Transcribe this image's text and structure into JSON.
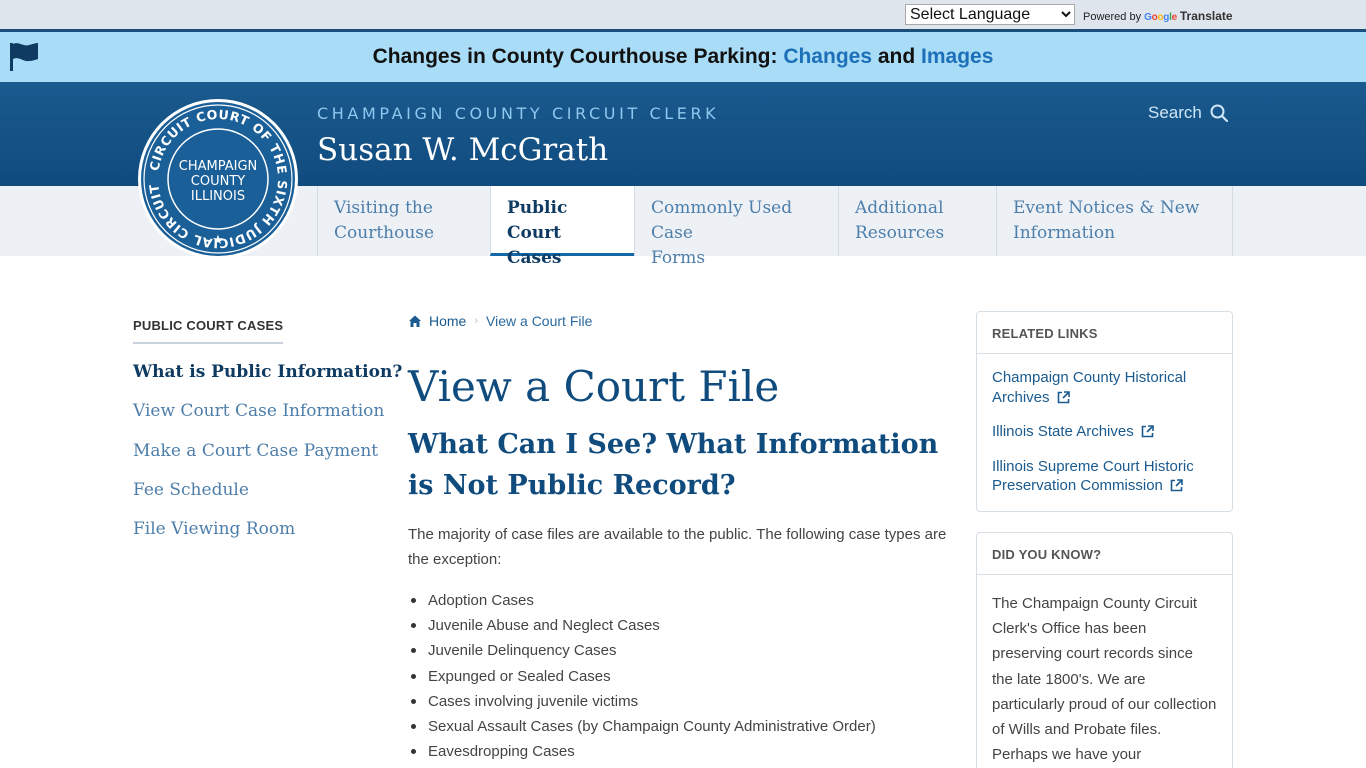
{
  "translate": {
    "select_value": "Select Language",
    "powered_by": "Powered by",
    "google": [
      "G",
      "o",
      "o",
      "g",
      "l",
      "e"
    ],
    "translate_label": "Translate"
  },
  "alert": {
    "icon": "flag-icon",
    "text_before": "Changes in County Courthouse Parking: ",
    "link1": "Changes",
    "text_middle": " and ",
    "link2": "Images"
  },
  "header": {
    "agency": "CHAMPAIGN COUNTY CIRCUIT CLERK",
    "clerk_name": "Susan W. McGrath",
    "search_label": "Search",
    "search_icon": "search-icon",
    "seal": {
      "ring_text": "CIRCUIT COURT OF THE SIXTH JUDICIAL CIRCUIT",
      "line1": "CHAMPAIGN",
      "line2": "COUNTY",
      "line3": "ILLINOIS",
      "star": "★"
    }
  },
  "nav": {
    "tabs": [
      {
        "line1": "Visiting the",
        "line2": "Courthouse"
      },
      {
        "line1": "Public Court",
        "line2": "Cases"
      },
      {
        "line1": "Commonly Used Case",
        "line2": "Forms"
      },
      {
        "line1": "Additional",
        "line2": "Resources"
      },
      {
        "line1": "Event Notices & New",
        "line2": "Information"
      }
    ],
    "active_index": 1
  },
  "sidebar": {
    "heading": "PUBLIC COURT CASES",
    "items": [
      "What is Public Information?",
      "View Court Case Information",
      "Make a Court Case Payment",
      "Fee Schedule",
      "File Viewing Room"
    ]
  },
  "breadcrumb": {
    "home_icon": "home-icon",
    "home": "Home",
    "separator": "›",
    "current": "View a Court File"
  },
  "main": {
    "title": "View a Court File",
    "subtitle": "What Can I See? What Information is Not Public Record?",
    "intro": "The majority of case files are available to the public. The following case types are the exception:",
    "exceptions": [
      "Adoption Cases",
      "Juvenile Abuse and Neglect Cases",
      "Juvenile Delinquency Cases",
      "Expunged or Sealed Cases",
      "Cases involving juvenile victims",
      "Sexual Assault Cases (by Champaign County Administrative Order)",
      "Eavesdropping Cases"
    ]
  },
  "related": {
    "heading": "RELATED LINKS",
    "external_icon": "external-link-icon",
    "links": [
      "Champaign County Historical Archives",
      "Illinois State Archives",
      "Illinois Supreme Court Historic Preservation Commission"
    ]
  },
  "did_you_know": {
    "heading": "DID YOU KNOW?",
    "text": "The Champaign County Circuit Clerk's Office has been preserving court records since the late 1800's. We are particularly proud of our collection of Wills and Probate files. Perhaps we have your"
  },
  "colors": {
    "header_blue": "#104b7e",
    "alert_bg": "#a9dcf6",
    "link_blue": "#1d70b8",
    "nav_bg": "#edf1f6"
  }
}
